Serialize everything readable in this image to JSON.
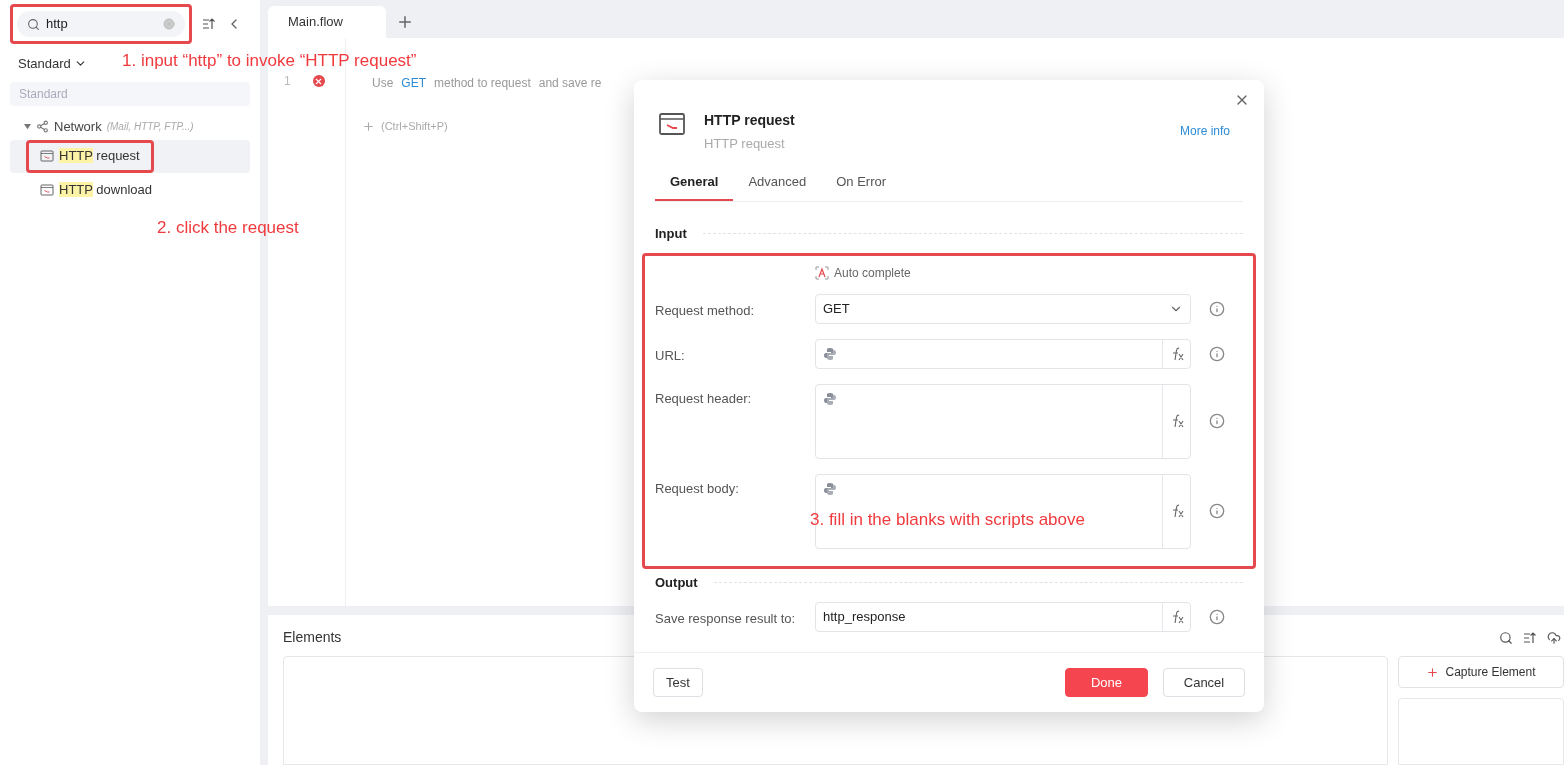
{
  "sidebar": {
    "search": {
      "value": "http",
      "highlighted": true
    },
    "category_dropdown": "Standard",
    "category_label": "Standard",
    "tree": [
      {
        "label": "Network",
        "hint": "(Mail, HTTP, FTP...)",
        "expanded": true,
        "children": [
          {
            "match": "HTTP",
            "label": "request",
            "selected": true,
            "highlighted": true
          },
          {
            "match": "HTTP",
            "label": "download",
            "selected": false,
            "highlighted": false
          }
        ]
      }
    ]
  },
  "tabs": [
    {
      "label": "Main.flow",
      "selected": true
    }
  ],
  "flow": {
    "steps": [
      {
        "number": "1",
        "error": true,
        "description": [
          {
            "kind": "plain",
            "text": "Use"
          },
          {
            "kind": "keyword",
            "text": "GET"
          },
          {
            "kind": "plain",
            "text": "method to request"
          },
          {
            "kind": "plain",
            "text": "and save re"
          }
        ]
      }
    ],
    "add_hint": "(Ctrl+Shift+P)"
  },
  "elements_panel": {
    "title": "Elements",
    "capture_button": "Capture Element"
  },
  "dialog": {
    "title": "HTTP request",
    "subtitle": "HTTP request",
    "more_info": "More info",
    "tabs": [
      {
        "label": "General",
        "selected": true
      },
      {
        "label": "Advanced",
        "selected": false
      },
      {
        "label": "On Error",
        "selected": false
      }
    ],
    "input_heading": "Input",
    "auto_complete": "Auto complete",
    "highlighted": true,
    "fields": [
      {
        "kind": "select",
        "label": "Request method:",
        "value": "GET"
      },
      {
        "kind": "input",
        "label": "URL:"
      },
      {
        "kind": "textarea",
        "label": "Request header:"
      },
      {
        "kind": "textarea",
        "label": "Request body:"
      }
    ],
    "output_heading": "Output",
    "output_fields": [
      {
        "kind": "input",
        "label": "Save response result to:",
        "value": "http_response"
      }
    ],
    "buttons": [
      {
        "label": "Test",
        "kind": "secondary"
      },
      {
        "label": "Done",
        "kind": "primary"
      },
      {
        "label": "Cancel",
        "kind": "secondary"
      }
    ]
  },
  "annotations": [
    {
      "text": "1. input “http” to invoke “HTTP request”"
    },
    {
      "text": "2. click the request"
    },
    {
      "text": "3. fill in the blanks with scripts above"
    }
  ]
}
